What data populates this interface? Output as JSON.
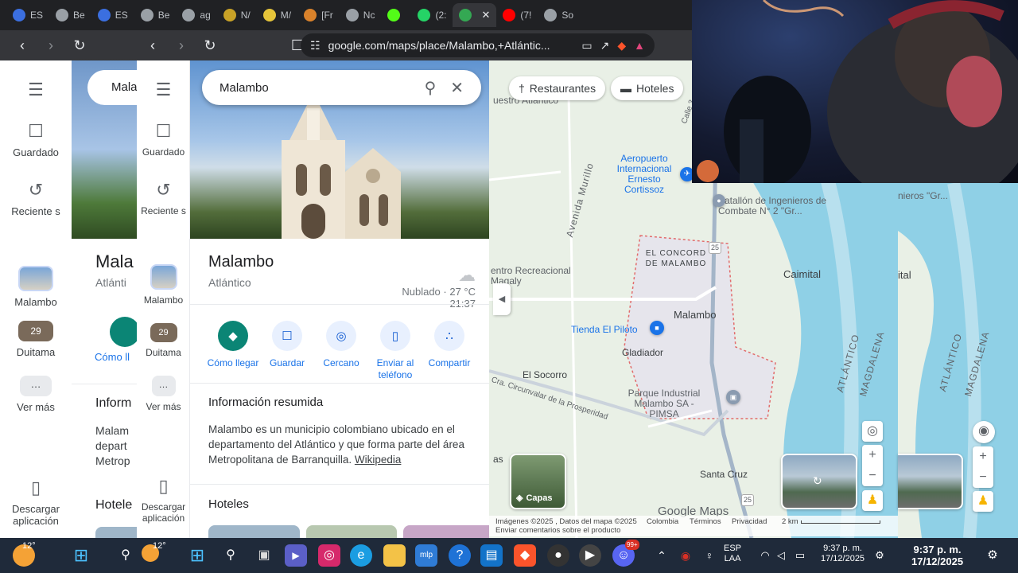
{
  "browser": {
    "tabs": [
      {
        "label": "ES",
        "icon": "brave-icon",
        "color": "#3b6fe0"
      },
      {
        "label": "Be",
        "icon": "globe-icon",
        "color": "#9aa0a6"
      },
      {
        "label": "ES",
        "icon": "brave-icon",
        "color": "#3b6fe0"
      },
      {
        "label": "Be",
        "icon": "globe-icon",
        "color": "#9aa0a6"
      },
      {
        "label": "ag",
        "icon": "globe-icon",
        "color": "#9aa0a6"
      },
      {
        "label": "N/",
        "icon": "globe-icon",
        "color": "#c9a227"
      },
      {
        "label": "M/",
        "icon": "globe-icon",
        "color": "#e5c43a"
      },
      {
        "label": "[Fr",
        "icon": "globe-icon",
        "color": "#d9822b"
      },
      {
        "label": "Nc",
        "icon": "globe-icon",
        "color": "#9aa0a6"
      },
      {
        "label": "",
        "icon": "kick-icon",
        "color": "#53fc18"
      },
      {
        "label": "(2:",
        "icon": "whatsapp-icon",
        "color": "#25d366"
      },
      {
        "label": "",
        "icon": "maps-icon",
        "color": "#34a853",
        "active": true
      },
      {
        "label": "(7!",
        "icon": "youtube-icon",
        "color": "#ff0000"
      },
      {
        "label": "So",
        "icon": "globe-icon",
        "color": "#9aa0a6"
      }
    ],
    "url": "google.com/maps/place/Malambo,+Atlántic..."
  },
  "ghost": {
    "search_value": "Mala",
    "title": "Mala",
    "sub": "Atlánti",
    "directions": "Cómo ll",
    "info_header": "Inform",
    "text1": "Malam",
    "text2": "depart",
    "text3": "Metrop",
    "hotels": "Hotele"
  },
  "rail": {
    "saved": "Guardado",
    "recents": "Reciente s",
    "place1": "Malambo",
    "place2": "Duitama",
    "more": "Ver más",
    "download": "Descargar aplicación"
  },
  "panel": {
    "search_value": "Malambo",
    "place_title": "Malambo",
    "place_sub": "Atlántico",
    "weather": "Nublado · 27 °C",
    "time": "21:37",
    "actions": [
      "Cómo llegar",
      "Guardar",
      "Cercano",
      "Enviar al teléfono",
      "Compartir"
    ],
    "summary_header": "Información resumida",
    "summary_text": "Malambo es un municipio colombiano ubicado en el departamento del Atlántico y que forma parte del área Metropolitana de Barranquilla.",
    "summary_link": "Wikipedia",
    "hotels_header": "Hoteles"
  },
  "map": {
    "chips": [
      "Restaurantes",
      "Hoteles"
    ],
    "labels": {
      "recreativo_top": "uestro Atlántico",
      "airport": "Aeropuerto Internacional Ernesto Cortissoz",
      "battalion": "Batallón de Ingenieros de Combate N° 2 \"Gr...",
      "concord": "EL CONCORD DE MALAMBO",
      "centro": "entro Recreacional Magaly",
      "caimital": "Caimital",
      "malambo": "Malambo",
      "tienda": "Tienda El Piloto",
      "gladiador": "Gladiador",
      "socorro": "El Socorro",
      "parque": "Parque Industrial Malambo SA - PIMSA",
      "santacruz": "Santa Cruz",
      "avenida": "Avenida Murillo",
      "circunvalar": "Cra. Circunvalar de la Prosperidad",
      "atlantico_v": "ATLÁNTICO",
      "magdalena_v": "MAGDALENA",
      "calle": "Calle 3",
      "edge_left": "as",
      "dup_battalion": "nieros \"Gr...",
      "dup_ital": "ital",
      "road25": "25"
    },
    "layers_label": "Capas",
    "attribution": "Imágenes ©2025 , Datos del mapa ©2025",
    "feedback": "Enviar comentarios sobre el producto",
    "links": [
      "Colombia",
      "Términos",
      "Privacidad"
    ],
    "scale": "2 km",
    "logo": "Google Maps"
  },
  "taskbar": {
    "temp": "12°",
    "lang": "ESP",
    "lang2": "LAA",
    "time": "9:37 p. m.",
    "date": "17/12/2025",
    "badge_discord": "99+"
  }
}
